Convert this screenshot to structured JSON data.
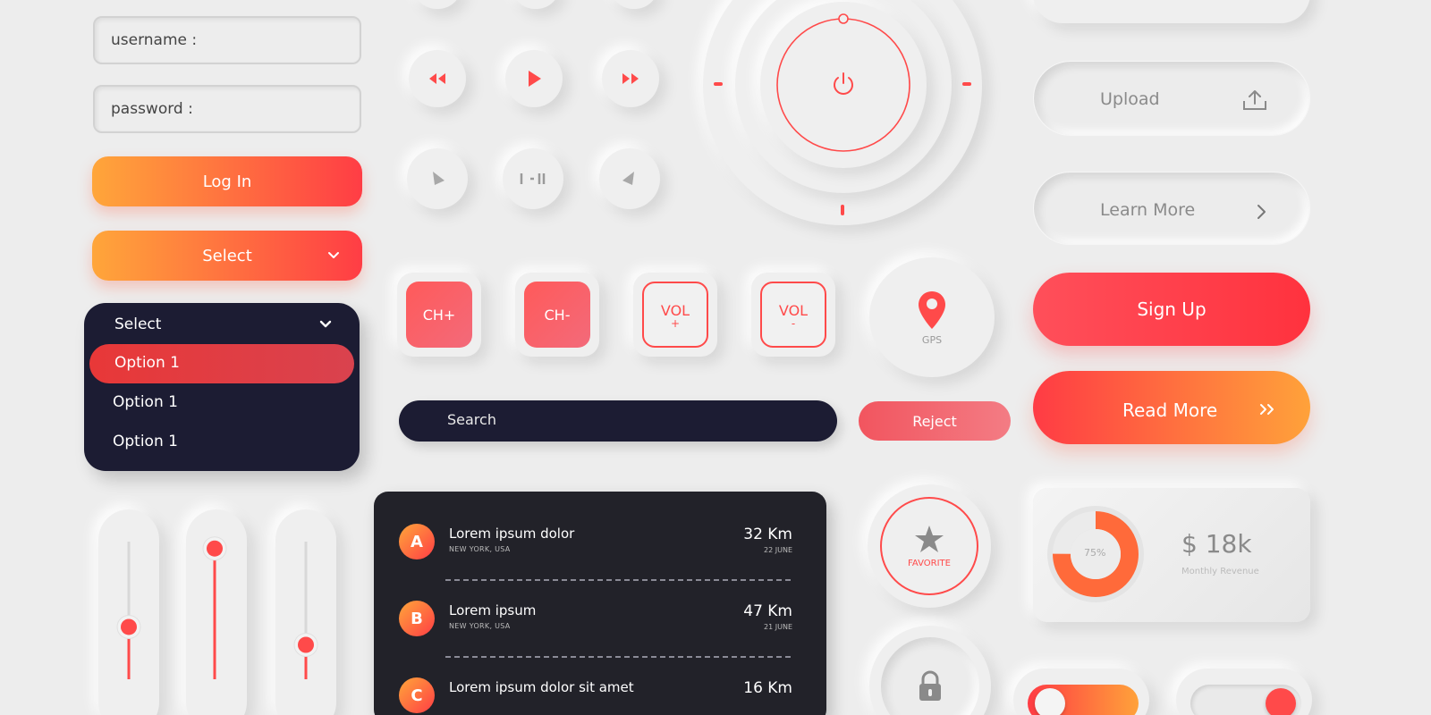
{
  "colors": {
    "accent_orange": "#ffa63a",
    "accent_red": "#ff3d45",
    "dark_panel": "#1c1c33",
    "background": "#ededed"
  },
  "login": {
    "username_placeholder": "username :",
    "password_placeholder": "password :",
    "login_label": "Log In",
    "select_label": "Select"
  },
  "dropdown": {
    "header": "Select",
    "options": [
      "Option 1",
      "Option 1",
      "Option 1"
    ]
  },
  "media": {
    "icons": [
      "rewind-icon",
      "play-icon",
      "fast-forward-icon",
      "play-left-icon",
      "pause-icon",
      "play-right-icon"
    ]
  },
  "tv": {
    "ch_plus": "CH+",
    "ch_minus": "CH-",
    "vol": "VOL",
    "vol_plus": "+",
    "vol_minus": "-",
    "gps": "GPS"
  },
  "search": {
    "placeholder": "Search",
    "reject_label": "Reject"
  },
  "right": {
    "upload_label": "Upload",
    "learn_more_label": "Learn More",
    "sign_up_label": "Sign Up",
    "read_more_label": "Read More"
  },
  "list": {
    "items": [
      {
        "initial": "A",
        "title": "Lorem ipsum dolor",
        "subtitle": "NEW YORK, USA",
        "distance": "32 Km",
        "date": "22 JUNE"
      },
      {
        "initial": "B",
        "title": "Lorem ipsum",
        "subtitle": "NEW YORK, USA",
        "distance": "47 Km",
        "date": "21 JUNE"
      },
      {
        "initial": "C",
        "title": "Lorem ipsum dolor sit amet",
        "subtitle": "",
        "distance": "16 Km",
        "date": ""
      }
    ]
  },
  "favorite": {
    "label": "FAVORITE"
  },
  "revenue": {
    "percent_label": "75%",
    "progress_fraction": 0.75,
    "amount": "$ 18k",
    "caption": "Monthly Revenue"
  },
  "sliders": {
    "levels": [
      0.38,
      0.95,
      0.25
    ]
  }
}
